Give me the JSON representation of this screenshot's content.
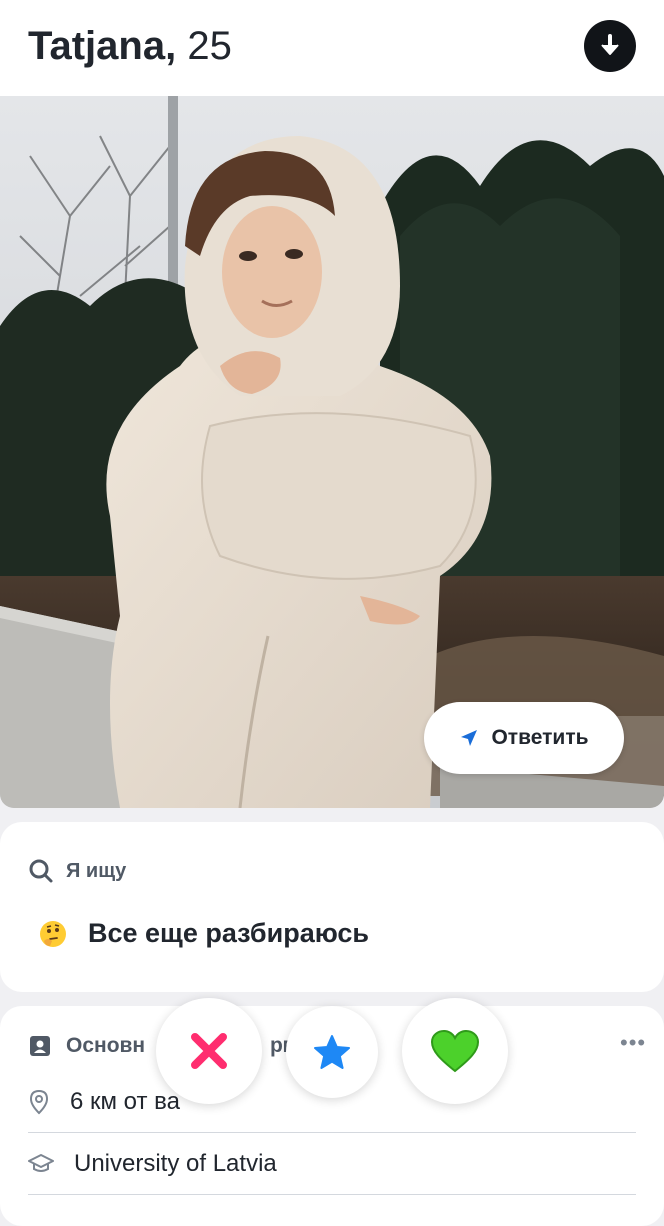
{
  "profile": {
    "name": "Tatjana",
    "separator": ",",
    "age": "25"
  },
  "photo": {
    "reply_label": "Ответить"
  },
  "looking_for": {
    "heading": "Я ищу",
    "value": "Все еще разбираюсь",
    "emoji": "thinking-face"
  },
  "basic_info": {
    "heading": "Основн",
    "heading_tail": "рм",
    "distance": "6 км от ва",
    "education": "University of Latvia"
  },
  "actions": {
    "nope_icon": "x-icon",
    "super_like_icon": "star-icon",
    "like_icon": "heart-icon"
  },
  "colors": {
    "accent_red": "#ff2d6f",
    "star_blue": "#1e88f5",
    "heart_green": "#4cd12b",
    "reply_arrow": "#1a6dd8"
  }
}
